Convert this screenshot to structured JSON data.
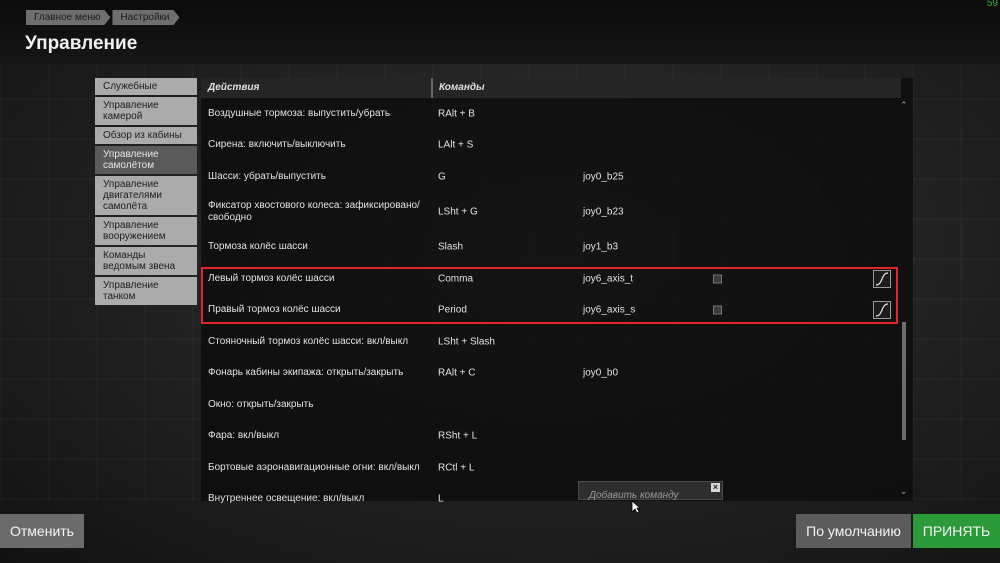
{
  "breadcrumb": [
    "Главное меню",
    "Настройки"
  ],
  "page_title": "Управление",
  "fps": "59",
  "categories": [
    {
      "label": "Служебные",
      "active": false
    },
    {
      "label": "Управление камерой",
      "active": false
    },
    {
      "label": "Обзор из кабины",
      "active": false
    },
    {
      "label": "Управление самолётом",
      "active": true
    },
    {
      "label": "Управление двигателями самолёта",
      "active": false
    },
    {
      "label": "Управление вооружением",
      "active": false
    },
    {
      "label": "Команды ведомым звена",
      "active": false
    },
    {
      "label": "Управление танком",
      "active": false
    }
  ],
  "table": {
    "header_actions": "Действия",
    "header_commands": "Команды",
    "rows": [
      {
        "action": "Воздушные тормоза: выпустить/убрать",
        "cmd1": "RAlt + B",
        "cmd2": ""
      },
      {
        "action": "Сирена: включить/выключить",
        "cmd1": "LAlt + S",
        "cmd2": ""
      },
      {
        "action": "Шасси: убрать/выпустить",
        "cmd1": "G",
        "cmd2": "joy0_b25"
      },
      {
        "action": "Фиксатор хвостового колеса: зафиксировано/свободно",
        "cmd1": "LSht + G",
        "cmd2": "joy0_b23"
      },
      {
        "action": "Тормоза колёс шасси",
        "cmd1": "Slash",
        "cmd2": "joy1_b3"
      },
      {
        "action": "Левый тормоз колёс шасси",
        "cmd1": "Comma",
        "cmd2": "joy6_axis_t",
        "axis": true
      },
      {
        "action": "Правый тормоз колёс шасси",
        "cmd1": "Period",
        "cmd2": "joy6_axis_s",
        "axis": true
      },
      {
        "action": "Стояночный тормоз колёс шасси: вкл/выкл",
        "cmd1": "LSht + Slash",
        "cmd2": ""
      },
      {
        "action": "Фонарь кабины экипажа: открыть/закрыть",
        "cmd1": "RAlt + C",
        "cmd2": "joy0_b0"
      },
      {
        "action": "Окно: открыть/закрыть",
        "cmd1": "",
        "cmd2": ""
      },
      {
        "action": "Фара: вкл/выкл",
        "cmd1": "RSht + L",
        "cmd2": ""
      },
      {
        "action": "Бортовые аэронавигационные огни: вкл/выкл",
        "cmd1": "RCtl + L",
        "cmd2": ""
      },
      {
        "action": "Внутреннее освещение: вкл/выкл",
        "cmd1": "L",
        "cmd2": ""
      }
    ]
  },
  "add_command_placeholder": "Добавить команду",
  "buttons": {
    "cancel": "Отменить",
    "default": "По умолчанию",
    "accept": "ПРИНЯТЬ"
  },
  "colors": {
    "accept": "#2d9a3a",
    "highlight": "#e0262d"
  }
}
